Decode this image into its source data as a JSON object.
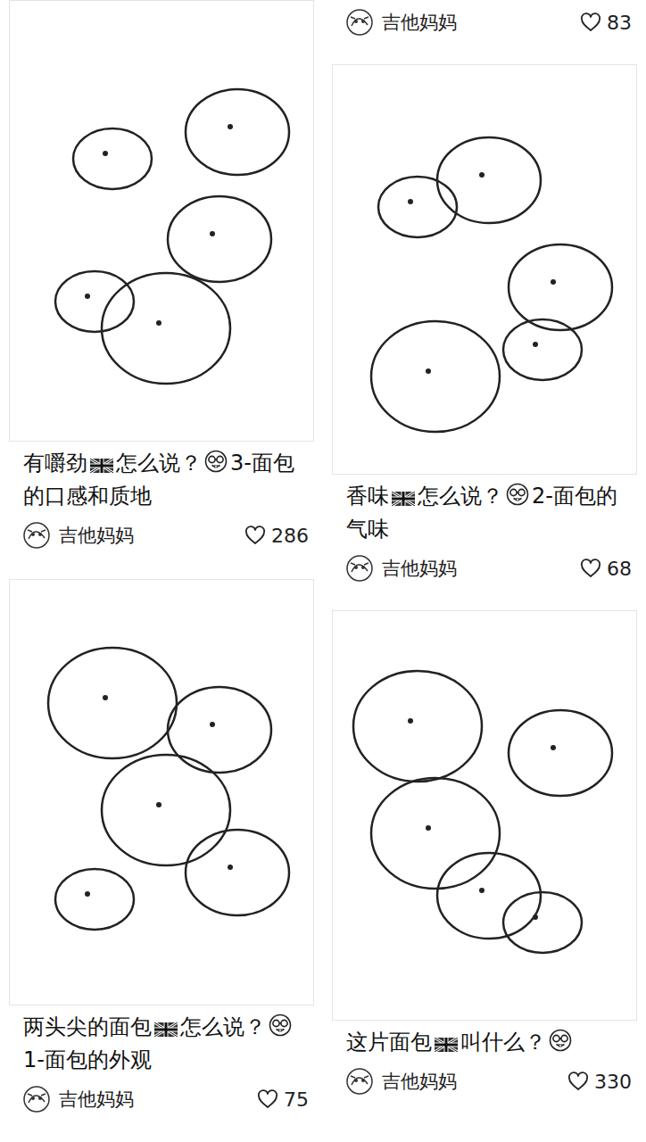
{
  "columns": [
    {
      "cards": [
        {
          "kind": "note",
          "title": [
            {
              "kind": "text",
              "text": "有嚼劲"
            },
            {
              "kind": "flag"
            },
            {
              "kind": "text",
              "text": "怎么说？"
            },
            {
              "kind": "nerd"
            },
            {
              "kind": "text",
              "text": "3-面包的口感和质地"
            }
          ],
          "author": "吉他妈妈",
          "likes": "286"
        },
        {
          "kind": "note",
          "title": [
            {
              "kind": "text",
              "text": "两头尖的面包"
            },
            {
              "kind": "flag"
            },
            {
              "kind": "text",
              "text": "怎么说？"
            },
            {
              "kind": "nerd"
            },
            {
              "kind": "text",
              "text": "1-面包的外观"
            }
          ],
          "author": "吉他妈妈",
          "likes": "75"
        }
      ]
    },
    {
      "cards": [
        {
          "kind": "author-only",
          "author": "吉他妈妈",
          "likes": "83"
        },
        {
          "kind": "note",
          "title": [
            {
              "kind": "text",
              "text": "香味"
            },
            {
              "kind": "flag"
            },
            {
              "kind": "text",
              "text": "怎么说？"
            },
            {
              "kind": "nerd"
            },
            {
              "kind": "text",
              "text": "2-面包的气味"
            }
          ],
          "author": "吉他妈妈",
          "likes": "68"
        },
        {
          "kind": "note",
          "title": [
            {
              "kind": "text",
              "text": "这片面包"
            },
            {
              "kind": "flag"
            },
            {
              "kind": "text",
              "text": "叫什么？"
            },
            {
              "kind": "nerd"
            }
          ],
          "author": "吉他妈妈",
          "likes": "330"
        }
      ]
    }
  ]
}
